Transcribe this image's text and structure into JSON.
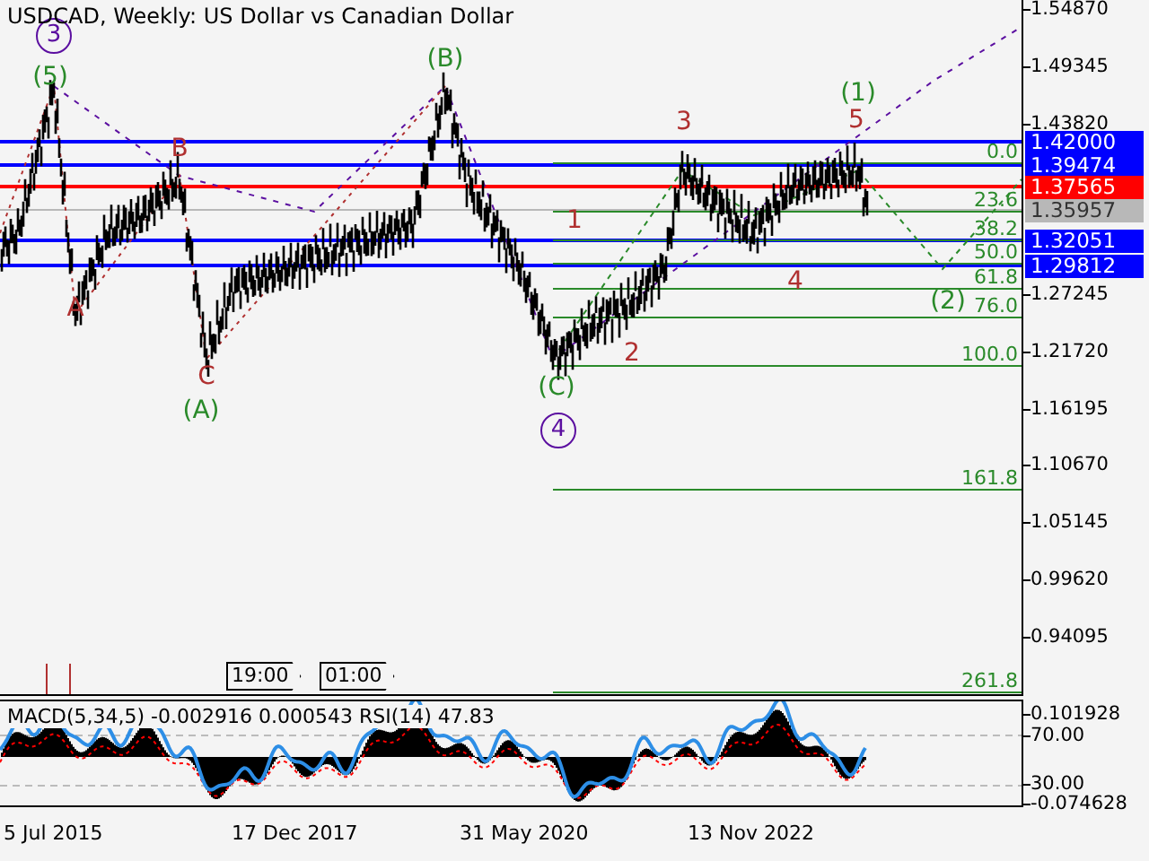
{
  "chart": {
    "title": "USDCAD, Weekly:  US Dollar vs Canadian Dollar",
    "price_axis": [
      "1.54870",
      "1.49345",
      "1.43820",
      "1.27245",
      "1.21720",
      "1.16195",
      "1.10670",
      "1.05145",
      "0.99620",
      "0.94095"
    ],
    "price_tags": [
      {
        "label": "1.42000",
        "color": "#0000ff"
      },
      {
        "label": "1.39474",
        "color": "#0000ff"
      },
      {
        "label": "1.37565",
        "color": "#ff0000"
      },
      {
        "label": "1.35957",
        "color": "#b8b8b8"
      },
      {
        "label": "1.32051",
        "color": "#0000ff"
      },
      {
        "label": "1.29812",
        "color": "#0000ff"
      }
    ],
    "fib_levels": [
      "0.0",
      "23.6",
      "38.2",
      "50.0",
      "61.8",
      "76.0",
      "100.0",
      "161.8",
      "261.8"
    ],
    "wave_labels": [
      {
        "text": "3",
        "kind": "circled",
        "color": "#5b0fa0"
      },
      {
        "text": "(5)",
        "kind": "plain",
        "color": "#2a8a2a"
      },
      {
        "text": "(B)",
        "kind": "plain",
        "color": "#2a8a2a"
      },
      {
        "text": "A",
        "kind": "plain",
        "color": "#b03030"
      },
      {
        "text": "B",
        "kind": "plain",
        "color": "#b03030"
      },
      {
        "text": "C",
        "kind": "plain",
        "color": "#b03030"
      },
      {
        "text": "(A)",
        "kind": "plain",
        "color": "#2a8a2a"
      },
      {
        "text": "(C)",
        "kind": "plain",
        "color": "#2a8a2a"
      },
      {
        "text": "4",
        "kind": "circled",
        "color": "#5b0fa0"
      },
      {
        "text": "1",
        "kind": "plain",
        "color": "#b03030"
      },
      {
        "text": "2",
        "kind": "plain",
        "color": "#b03030"
      },
      {
        "text": "3",
        "kind": "plain",
        "color": "#b03030"
      },
      {
        "text": "4",
        "kind": "plain",
        "color": "#b03030"
      },
      {
        "text": "5",
        "kind": "plain",
        "color": "#b03030"
      },
      {
        "text": "(1)",
        "kind": "plain",
        "color": "#2a8a2a"
      },
      {
        "text": "(2)",
        "kind": "plain",
        "color": "#2a8a2a"
      }
    ],
    "time_markers": [
      "19:00",
      "01:00"
    ]
  },
  "indicator": {
    "label": "MACD(5,34,5) -0.002916 0.000543 RSI(14) 47.83",
    "axis": [
      "0.101928",
      "70.00",
      "30.00",
      "-0.074628"
    ]
  },
  "time_axis": [
    "5 Jul 2015",
    "17 Dec 2017",
    "31 May 2020",
    "13 Nov 2022"
  ]
}
